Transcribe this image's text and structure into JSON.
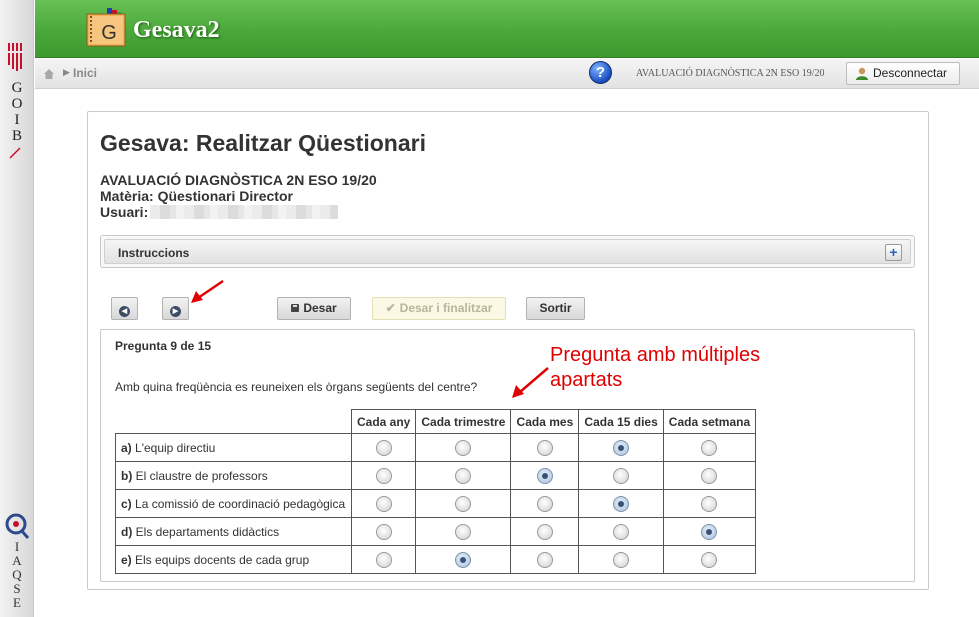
{
  "gov_strip": {
    "logo_letters": [
      "G",
      "O",
      "I",
      "B"
    ],
    "iaqse_letters": [
      "I",
      "A",
      "Q",
      "S",
      "E"
    ]
  },
  "header": {
    "app_title": "Gesava2",
    "logo_letter": "G"
  },
  "breadcrumb": {
    "home_label": "Inici",
    "session_info": "AVALUACIÓ DIAGNÒSTICA 2N ESO 19/20",
    "logout_label": "Desconnectar",
    "help_glyph": "?"
  },
  "page": {
    "title": "Gesava: Realitzar Qüestionari",
    "evaluation": "AVALUACIÓ DIAGNÒSTICA 2N ESO 19/20",
    "subject": "Matèria: Qüestionari Director",
    "user_label": "Usuari:"
  },
  "instructions": {
    "label": "Instruccions",
    "expand_glyph": "+"
  },
  "toolbar": {
    "prev_glyph": "◀",
    "next_glyph": "▶",
    "save_label": "Desar",
    "save_finish_label": "Desar i finalitzar",
    "save_finish_glyph": "✔",
    "exit_label": "Sortir"
  },
  "question": {
    "counter": "Pregunta 9 de 15",
    "text": "Amb quina freqüència es reuneixen els òrgans següents del centre?",
    "columns": [
      "Cada any",
      "Cada trimestre",
      "Cada mes",
      "Cada 15 dies",
      "Cada setmana"
    ],
    "rows": [
      {
        "letter": "a)",
        "label": "L'equip directiu",
        "selected": 3
      },
      {
        "letter": "b)",
        "label": "El claustre de professors",
        "selected": 2
      },
      {
        "letter": "c)",
        "label": "La comissió de coordinació pedagògica",
        "selected": 3
      },
      {
        "letter": "d)",
        "label": "Els departaments didàctics",
        "selected": 4
      },
      {
        "letter": "e)",
        "label": "Els equips docents de cada grup",
        "selected": 1
      }
    ]
  },
  "annotation": {
    "line1": "Pregunta amb múltiples",
    "line2": "apartats",
    "color": "#e00000"
  },
  "colors": {
    "header_green": "#4aa83a",
    "annotation_red": "#e00000"
  }
}
